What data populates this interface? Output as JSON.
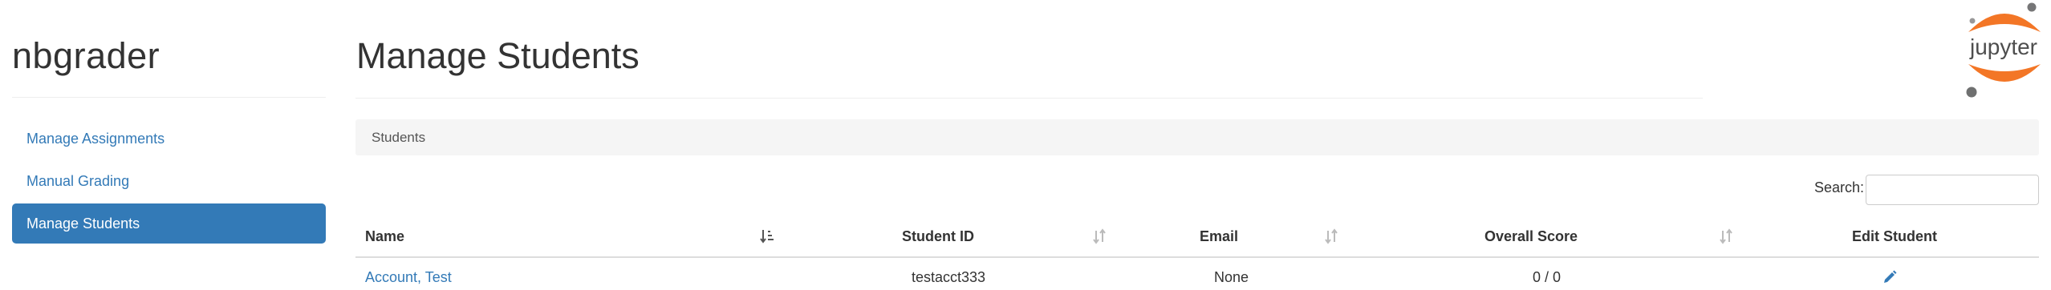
{
  "app": {
    "title": "nbgrader"
  },
  "sidebar": {
    "items": [
      {
        "label": "Manage Assignments",
        "active": false
      },
      {
        "label": "Manual Grading",
        "active": false
      },
      {
        "label": "Manage Students",
        "active": true
      }
    ]
  },
  "logo": {
    "icon": "jupyter-logo-icon",
    "text": "jupyter",
    "color": "#f37626"
  },
  "page": {
    "title": "Manage Students",
    "panel_heading": "Students"
  },
  "search": {
    "label": "Search:",
    "value": ""
  },
  "table": {
    "columns": [
      "Name",
      "Student ID",
      "Email",
      "Overall Score",
      "Edit Student"
    ],
    "sort": {
      "column": "Name",
      "direction": "ascending"
    },
    "rows": [
      {
        "name": "Account, Test",
        "student_id": "testacct333",
        "email": "None",
        "overall_score": "0 / 0",
        "edit_icon": "pencil-icon"
      }
    ]
  },
  "colors": {
    "accent": "#337ab7",
    "panel_bg": "#f5f5f5",
    "text": "#333333"
  }
}
